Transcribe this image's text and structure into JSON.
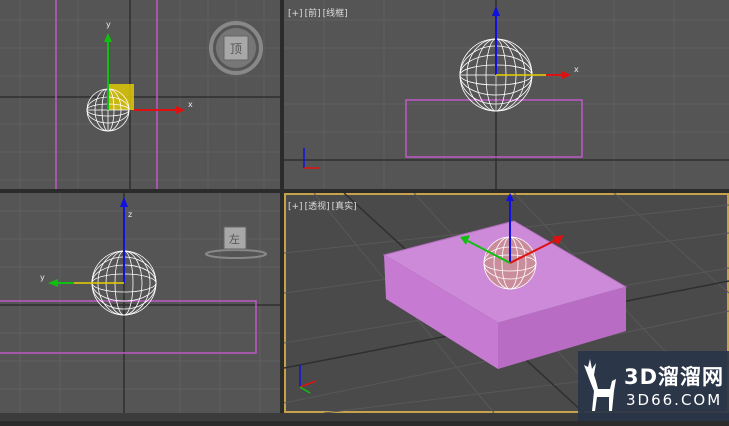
{
  "viewports": {
    "top_left": {
      "axis_x": "x",
      "axis_y": "y",
      "viewcube": "顶"
    },
    "top_right": {
      "label_plus": "[+]",
      "label_view": "[前]",
      "label_mode": "[线框]",
      "axis_x": "x"
    },
    "bottom_left": {
      "axis_y": "y",
      "axis_z": "z",
      "viewcube": "左"
    },
    "bottom_right": {
      "label_plus": "[+]",
      "label_view": "[透视]",
      "label_mode": "[真实]"
    }
  },
  "watermark": {
    "brand": "3D溜溜网",
    "site": "3D66.COM"
  },
  "colors": {
    "viewport_bg": "#555555",
    "grid": "#5f5f5f",
    "grid_axis": "#3a3a3a",
    "box_outline": "#c058c8",
    "box_fill": "#c98ad6",
    "wire": "#ffffff",
    "axis_x": "#e01010",
    "axis_y": "#10c010",
    "axis_z": "#1010e0",
    "active_border": "#c8a24a",
    "gizmo_yellow": "#e8d000"
  }
}
